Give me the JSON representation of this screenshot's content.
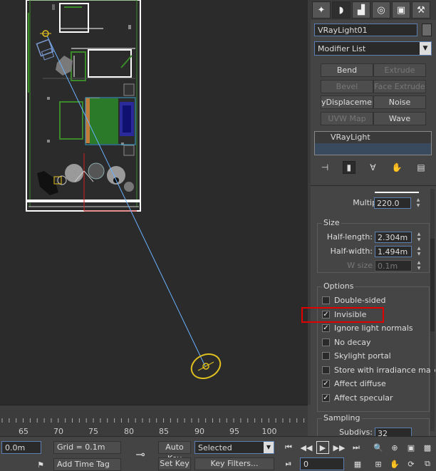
{
  "panel": {
    "tabs": [
      {
        "icon": "create-icon",
        "glyph": "✦"
      },
      {
        "icon": "modify-icon",
        "glyph": "◗"
      },
      {
        "icon": "hierarchy-icon",
        "glyph": "▟"
      },
      {
        "icon": "motion-icon",
        "glyph": "◎"
      },
      {
        "icon": "display-icon",
        "glyph": "▣"
      },
      {
        "icon": "utilities-icon",
        "glyph": "⚒"
      }
    ],
    "object_name": "VRayLight01",
    "modifier_list": "Modifier List",
    "modifier_buttons": [
      {
        "label": "Bend",
        "enabled": true
      },
      {
        "label": "Extrude",
        "enabled": false
      },
      {
        "label": "Bevel",
        "enabled": false
      },
      {
        "label": "Face Extrude",
        "enabled": false
      },
      {
        "label": "yDisplacement",
        "enabled": true
      },
      {
        "label": "Noise",
        "enabled": true
      },
      {
        "label": "UVW Map",
        "enabled": false
      },
      {
        "label": "Wave",
        "enabled": true
      }
    ],
    "stack_item": "VRayLight",
    "stack_tools": [
      "pin-stack-icon",
      "show-end-result-icon",
      "make-unique-icon",
      "remove-modifier-icon",
      "configure-sets-icon"
    ],
    "multiplier_label": "Multiplier:",
    "multiplier_value": "220.0",
    "size_group": "Size",
    "half_length_label": "Half-length:",
    "half_length_value": "2.304m",
    "half_width_label": "Half-width:",
    "half_width_value": "1.494m",
    "w_size_label": "W size",
    "w_size_value": "0.1m",
    "options_group": "Options",
    "options": [
      {
        "label": "Double-sided",
        "checked": false
      },
      {
        "label": "Invisible",
        "checked": true
      },
      {
        "label": "Ignore light normals",
        "checked": true
      },
      {
        "label": "No decay",
        "checked": false
      },
      {
        "label": "Skylight portal",
        "checked": false
      },
      {
        "label": "Store with irradiance map",
        "checked": false
      },
      {
        "label": "Affect diffuse",
        "checked": true
      },
      {
        "label": "Affect specular",
        "checked": true
      }
    ],
    "sampling_group": "Sampling",
    "subdivs_label": "Subdivs:",
    "subdivs_value": "32"
  },
  "timeline": {
    "ticks": [
      "65",
      "70",
      "75",
      "80",
      "85",
      "90",
      "95",
      "100"
    ]
  },
  "bottom": {
    "coord_value": "0.0m",
    "grid_label": "Grid = 0.1m",
    "auto_key": "Auto Key",
    "selected": "Selected",
    "set_key": "Set Key",
    "key_filters": "Key Filters...",
    "add_time_tag": "Add Time Tag",
    "frame_value": "0"
  }
}
